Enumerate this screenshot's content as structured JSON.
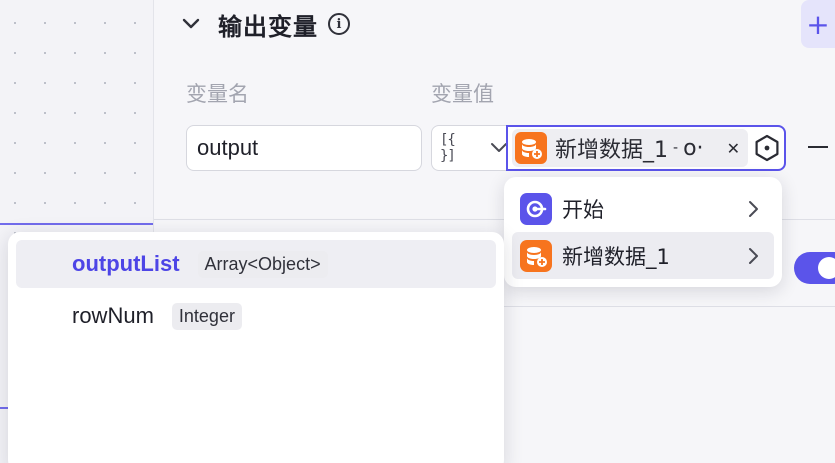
{
  "section": {
    "title": "输出变量"
  },
  "columns": {
    "name_label": "变量名",
    "value_label": "变量值"
  },
  "row": {
    "name_value": "output",
    "type_glyph": "[{ }]",
    "value_tag": {
      "node": "新增数据_1",
      "field": "o·"
    }
  },
  "node_dropdown": {
    "items": [
      {
        "label": "开始"
      },
      {
        "label": "新增数据_1"
      }
    ]
  },
  "field_dropdown": {
    "items": [
      {
        "name": "outputList",
        "type": "Array<Object>"
      },
      {
        "name": "rowNum",
        "type": "Integer"
      }
    ]
  },
  "colors": {
    "accent": "#5b54ea",
    "db_node": "#f7741e"
  }
}
